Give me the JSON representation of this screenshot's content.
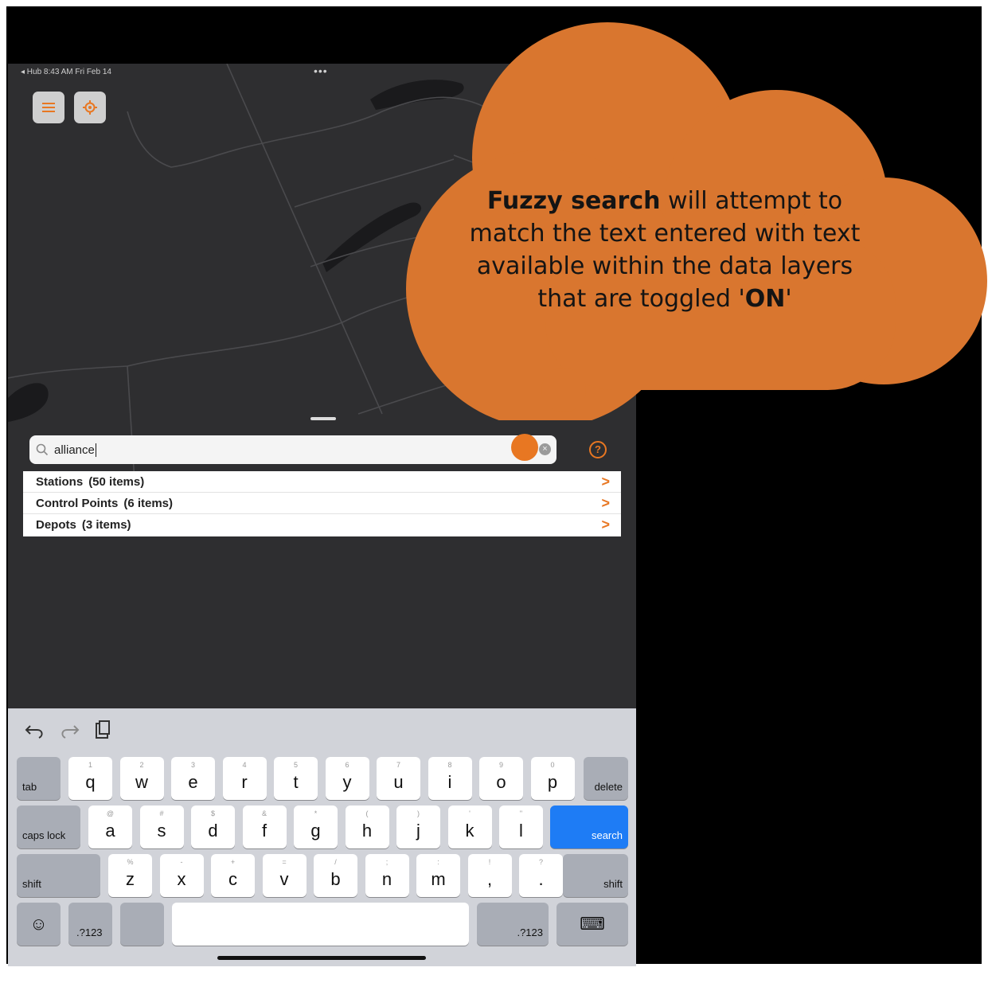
{
  "status_bar": {
    "left_text": "◂ Hub  8:43 AM   Fri Feb 14",
    "dots": "•••"
  },
  "search": {
    "value": "alliance",
    "clear": "×",
    "help": "?"
  },
  "results": [
    {
      "label": "Stations",
      "count": "(50 items)",
      "chevron": ">"
    },
    {
      "label": "Control Points",
      "count": "(6 items)",
      "chevron": ">"
    },
    {
      "label": "Depots",
      "count": "(3 items)",
      "chevron": ">"
    }
  ],
  "keyboard": {
    "row1": [
      {
        "label": "q",
        "sub": "1"
      },
      {
        "label": "w",
        "sub": "2"
      },
      {
        "label": "e",
        "sub": "3"
      },
      {
        "label": "r",
        "sub": "4"
      },
      {
        "label": "t",
        "sub": "5"
      },
      {
        "label": "y",
        "sub": "6"
      },
      {
        "label": "u",
        "sub": "7"
      },
      {
        "label": "i",
        "sub": "8"
      },
      {
        "label": "o",
        "sub": "9"
      },
      {
        "label": "p",
        "sub": "0"
      }
    ],
    "row2": [
      {
        "label": "a",
        "sub": "@"
      },
      {
        "label": "s",
        "sub": "#"
      },
      {
        "label": "d",
        "sub": "$"
      },
      {
        "label": "f",
        "sub": "&"
      },
      {
        "label": "g",
        "sub": "*"
      },
      {
        "label": "h",
        "sub": "("
      },
      {
        "label": "j",
        "sub": ")"
      },
      {
        "label": "k",
        "sub": "'"
      },
      {
        "label": "l",
        "sub": "\""
      }
    ],
    "row3": [
      {
        "label": "z",
        "sub": "%"
      },
      {
        "label": "x",
        "sub": "-"
      },
      {
        "label": "c",
        "sub": "+"
      },
      {
        "label": "v",
        "sub": "="
      },
      {
        "label": "b",
        "sub": "/"
      },
      {
        "label": "n",
        "sub": ";"
      },
      {
        "label": "m",
        "sub": ":"
      },
      {
        "label": ",",
        "sub": "!"
      },
      {
        "label": ".",
        "sub": "?"
      }
    ],
    "tab": "tab",
    "delete": "delete",
    "caps_lock": "caps lock",
    "search": "search",
    "shift_left": "shift",
    "shift_right": "shift",
    "numbers_left": ".?123",
    "numbers_right": ".?123",
    "emoji": "☺",
    "hide_keyboard": "⌨"
  },
  "callout": {
    "bold_lead": "Fuzzy search",
    "text_mid": " will attempt to match the text entered with text available within the data layers that are toggled '",
    "bold_on": "ON",
    "text_end": "'",
    "color": "#d9762f"
  },
  "colors": {
    "accent": "#e87722",
    "search_key": "#1e7cf5",
    "map_bg": "#2e2e30"
  }
}
